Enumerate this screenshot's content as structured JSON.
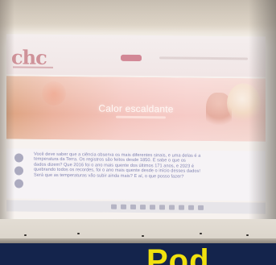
{
  "site": {
    "logo_text": "chc",
    "accent_color": "#c76678"
  },
  "banner": {
    "title": "Calor escaldante"
  },
  "article": {
    "lines": [
      "Você deve saber que a ciência observa os mais diferentes sinais, e uma delas é a",
      "temperatura da Terra. Os registros são feitos desde 1850. E sabe o que os",
      "dados dizem? Que 2016 foi o ano mais quente dos últimos 171 anos, e 2023 é",
      "quebrando todos os recordes, foi o ano mais quente desde o início desses dados!",
      "Será que as temperaturas vão subir ainda mais? E aí, o que posso fazer?"
    ]
  },
  "overlay": {
    "caption_text": "Pod",
    "caption_color": "#f1e10e"
  },
  "icons": [
    "facebook-icon",
    "twitter-icon",
    "whatsapp-icon"
  ]
}
